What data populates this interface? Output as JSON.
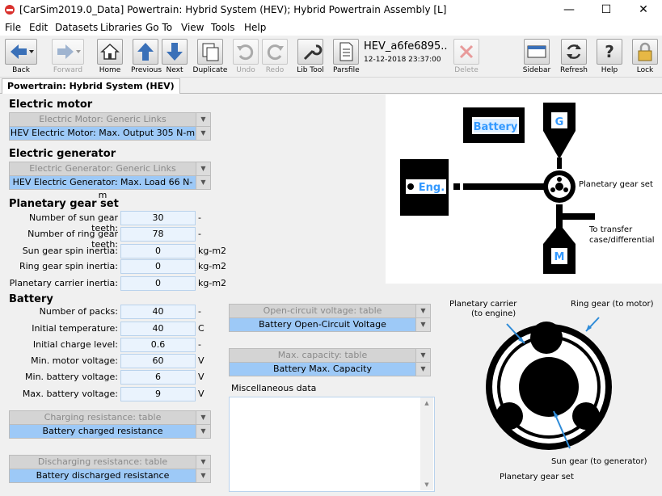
{
  "window": {
    "title": "[CarSim2019.0_Data] Powertrain: Hybrid System (HEV); Hybrid Powertrain Assembly [L]",
    "minimize": "—",
    "maximize": "☐",
    "close": "✕"
  },
  "menu": [
    "File",
    "Edit",
    "Datasets",
    "Libraries",
    "Go To",
    "View",
    "Tools",
    "Help"
  ],
  "toolbar": {
    "back": "Back",
    "forward": "Forward",
    "home": "Home",
    "previous": "Previous",
    "next": "Next",
    "duplicate": "Duplicate",
    "undo": "Undo",
    "redo": "Redo",
    "lib_tool": "Lib Tool",
    "parsfile": "Parsfile",
    "dataset_name": "HEV_a6fe6895..",
    "dataset_date": "12-12-2018 23:37:00",
    "delete": "Delete",
    "sidebar": "Sidebar",
    "refresh": "Refresh",
    "help": "Help",
    "lock": "Lock"
  },
  "tab": "Powertrain: Hybrid System (HEV)",
  "motor": {
    "title": "Electric motor",
    "category": "Electric Motor: Generic Links",
    "selected": "HEV Electric Motor: Max. Output 305 N-m"
  },
  "generator": {
    "title": "Electric generator",
    "category": "Electric Generator: Generic Links",
    "selected": "HEV Electric Generator: Max. Load 66 N-m"
  },
  "planetary": {
    "title": "Planetary gear set",
    "fields": [
      {
        "label": "Number of sun gear teeth:",
        "value": "30",
        "unit": "-"
      },
      {
        "label": "Number of ring gear teeth:",
        "value": "78",
        "unit": "-"
      },
      {
        "label": "Sun gear spin inertia:",
        "value": "0",
        "unit": "kg-m2"
      },
      {
        "label": "Ring gear spin inertia:",
        "value": "0",
        "unit": "kg-m2"
      },
      {
        "label": "Planetary carrier inertia:",
        "value": "0",
        "unit": "kg-m2"
      }
    ]
  },
  "battery": {
    "title": "Battery",
    "fields": [
      {
        "label": "Number of packs:",
        "value": "40",
        "unit": "-"
      },
      {
        "label": "Initial temperature:",
        "value": "40",
        "unit": "C"
      },
      {
        "label": "Initial charge level:",
        "value": "0.6",
        "unit": "-"
      },
      {
        "label": "Min. motor voltage:",
        "value": "60",
        "unit": "V"
      },
      {
        "label": "Min. battery voltage:",
        "value": "6",
        "unit": "V"
      },
      {
        "label": "Max. battery voltage:",
        "value": "9",
        "unit": "V"
      }
    ],
    "ocv_category": "Open-circuit voltage: table",
    "ocv_selected": "Battery Open-Circuit Voltage",
    "cap_category": "Max. capacity: table",
    "cap_selected": "Battery Max. Capacity",
    "charge_category": "Charging resistance: table",
    "charge_selected": "Battery charged resistance",
    "discharge_category": "Discharging resistance: table",
    "discharge_selected": "Battery discharged resistance"
  },
  "misc": {
    "label": "Miscellaneous data",
    "value": ""
  },
  "diagram": {
    "battery": "Battery",
    "generator": "G",
    "engine": "Eng.",
    "motor": "M",
    "planetary": "Planetary gear set",
    "transfer_line1": "To transfer",
    "transfer_line2": "case/differential"
  },
  "gear_diagram": {
    "carrier_line1": "Planetary carrier",
    "carrier_line2": "(to engine)",
    "ring": "Ring gear (to motor)",
    "sun": "Sun gear (to generator)",
    "title": "Planetary gear set"
  },
  "colors": {
    "selected_blue": "#9dc9f7",
    "label_blue": "#3399ff",
    "arrow_blue": "#2e8bd8"
  }
}
